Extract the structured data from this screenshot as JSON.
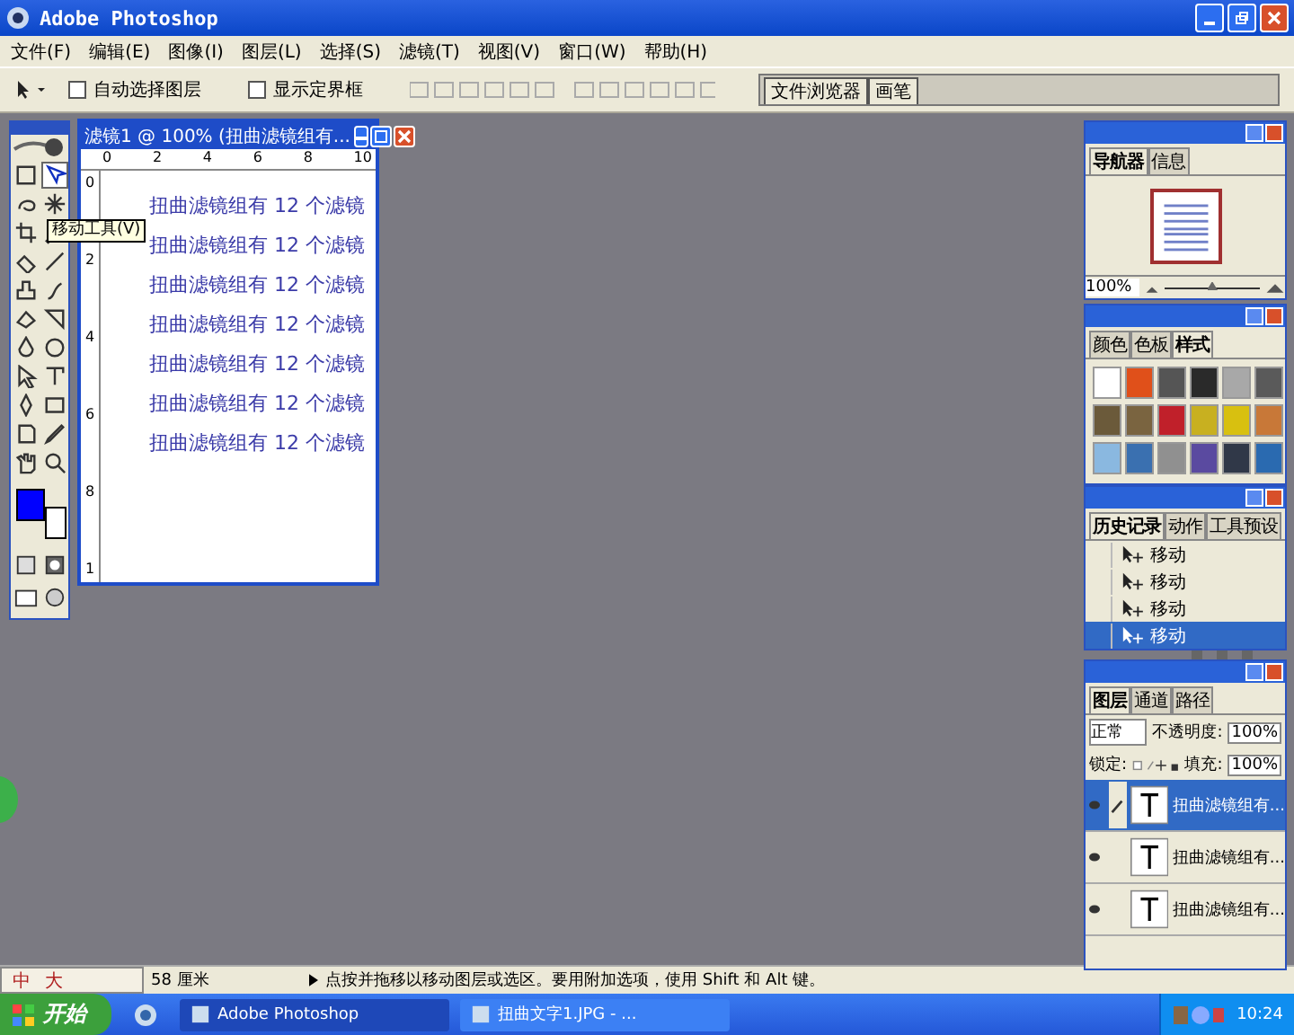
{
  "window": {
    "title": "Adobe Photoshop"
  },
  "menu": [
    "文件(F)",
    "编辑(E)",
    "图像(I)",
    "图层(L)",
    "选择(S)",
    "滤镜(T)",
    "视图(V)",
    "窗口(W)",
    "帮助(H)"
  ],
  "options_bar": {
    "checkboxes": [
      {
        "label": "自动选择图层",
        "checked": false
      },
      {
        "label": "显示定界框",
        "checked": false
      }
    ],
    "palette_well_tabs": [
      "文件浏览器",
      "画笔"
    ]
  },
  "toolbox": {
    "tooltip": "移动工具(V)",
    "tools": [
      {
        "selected": false
      },
      {
        "selected": true
      },
      {
        "selected": false
      },
      {
        "selected": false
      },
      {
        "selected": false
      },
      {
        "selected": false
      },
      {
        "selected": false
      },
      {
        "selected": false
      },
      {
        "selected": false
      },
      {
        "selected": false
      },
      {
        "selected": false
      },
      {
        "selected": false
      },
      {
        "selected": false
      },
      {
        "selected": false
      },
      {
        "selected": false
      },
      {
        "selected": false
      },
      {
        "selected": false
      },
      {
        "selected": false
      },
      {
        "selected": false
      },
      {
        "selected": false
      },
      {
        "selected": false
      },
      {
        "selected": false
      }
    ]
  },
  "document": {
    "title": "滤镜1 @ 100% (扭曲滤镜组有...",
    "ruler_h": [
      "0",
      "2",
      "4",
      "6",
      "8",
      "10"
    ],
    "ruler_v": [
      "0",
      "2",
      "4",
      "6",
      "8",
      "1"
    ],
    "lines": [
      "扭曲滤镜组有 12 个滤镜",
      "扭曲滤镜组有 12 个滤镜",
      "扭曲滤镜组有 12 个滤镜",
      "扭曲滤镜组有 12 个滤镜",
      "扭曲滤镜组有 12 个滤镜",
      "扭曲滤镜组有 12 个滤镜",
      "扭曲滤镜组有 12 个滤镜"
    ]
  },
  "navigator": {
    "tabs": [
      {
        "label": "导航器",
        "selected": true
      },
      {
        "label": "信息",
        "selected": false
      }
    ],
    "zoom": "100%",
    "level": 0.5
  },
  "styles": {
    "tabs": [
      {
        "label": "颜色",
        "selected": false
      },
      {
        "label": "色板",
        "selected": false
      },
      {
        "label": "样式",
        "selected": true
      }
    ],
    "swatches": [
      {
        "color": "#ffffff"
      },
      {
        "color": "#e0501a"
      },
      {
        "color": "#555555"
      },
      {
        "color": "#2a2a2a"
      },
      {
        "color": "#a8a8a8"
      },
      {
        "color": "#5a5a5a"
      },
      {
        "color": "#6b5a3a"
      },
      {
        "color": "#7a6440"
      },
      {
        "color": "#c0202a"
      },
      {
        "color": "#c8b020"
      },
      {
        "color": "#d8c010"
      },
      {
        "color": "#c87838"
      },
      {
        "color": "#8ab8e0"
      },
      {
        "color": "#3a70b0"
      },
      {
        "color": "#909090"
      },
      {
        "color": "#5a4aa0"
      },
      {
        "color": "#303848"
      },
      {
        "color": "#2a6ab0"
      }
    ]
  },
  "history": {
    "tabs": [
      {
        "label": "历史记录",
        "selected": true
      },
      {
        "label": "动作",
        "selected": false
      },
      {
        "label": "工具预设",
        "selected": false
      }
    ],
    "items": [
      {
        "label": "移动",
        "selected": false
      },
      {
        "label": "移动",
        "selected": false
      },
      {
        "label": "移动",
        "selected": false
      },
      {
        "label": "移动",
        "selected": true
      }
    ]
  },
  "layers": {
    "tabs": [
      {
        "label": "图层",
        "selected": true
      },
      {
        "label": "通道",
        "selected": false
      },
      {
        "label": "路径",
        "selected": false
      }
    ],
    "blend_mode": "正常",
    "opacity_label": "不透明度:",
    "opacity": "100%",
    "lock_label": "锁定:",
    "fill_label": "填充:",
    "fill": "100%",
    "items": [
      {
        "name": "扭曲滤镜组有...",
        "selected": true,
        "visible": true
      },
      {
        "name": "扭曲滤镜组有...",
        "selected": false,
        "visible": true
      },
      {
        "name": "扭曲滤镜组有...",
        "selected": false,
        "visible": true
      }
    ]
  },
  "status_bar": {
    "ime": [
      "中",
      "大"
    ],
    "size": "58 厘米",
    "hint": "点按并拖移以移动图层或选区。要用附加选项，使用 Shift 和 Alt 键。"
  },
  "taskbar": {
    "start": "开始",
    "tasks": [
      {
        "label": "Adobe Photoshop",
        "selected": true
      },
      {
        "label": "扭曲文字1.JPG - ...",
        "selected": false
      }
    ],
    "time": "10:24"
  }
}
